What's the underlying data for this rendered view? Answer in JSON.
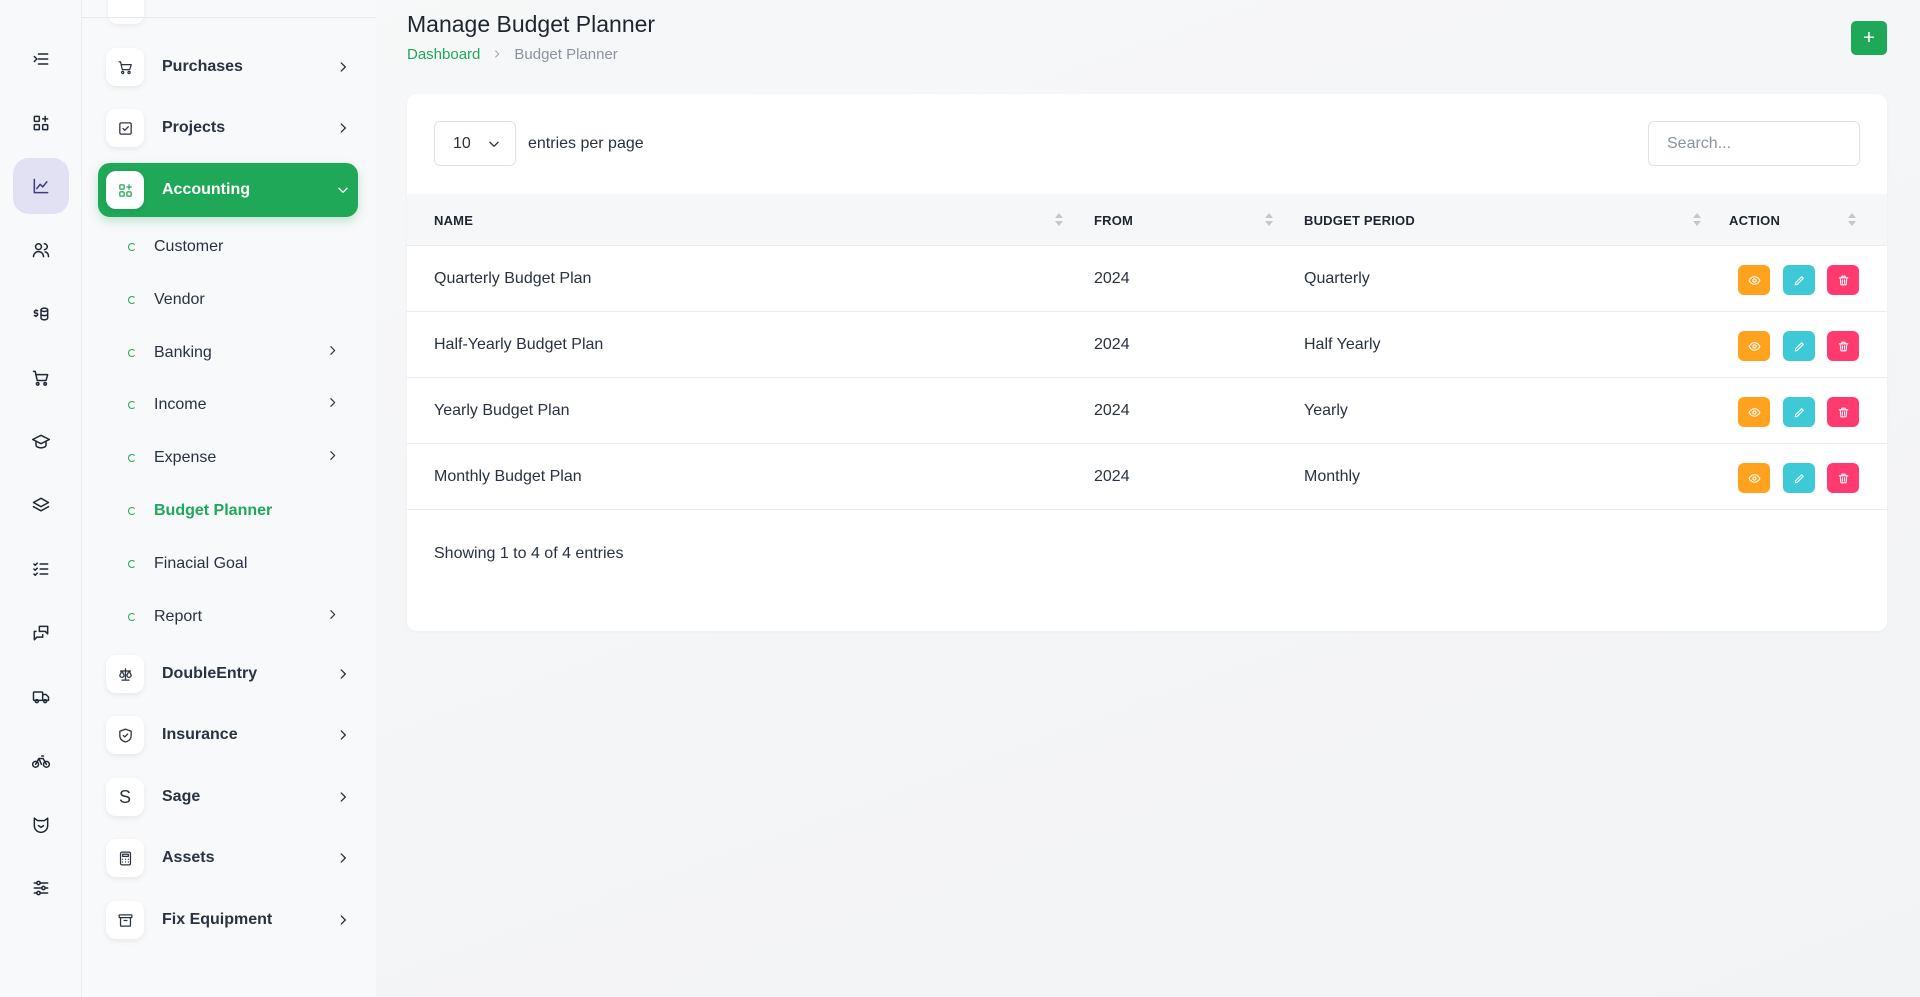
{
  "sidebar": {
    "items_top": [
      {
        "label": "Purchases"
      },
      {
        "label": "Projects"
      },
      {
        "label": "Accounting"
      }
    ],
    "accounting_sub": [
      {
        "label": "Customer"
      },
      {
        "label": "Vendor"
      },
      {
        "label": "Banking"
      },
      {
        "label": "Income"
      },
      {
        "label": "Expense"
      },
      {
        "label": "Budget Planner"
      },
      {
        "label": "Finacial Goal"
      },
      {
        "label": "Report"
      }
    ],
    "items_bottom": [
      {
        "label": "DoubleEntry"
      },
      {
        "label": "Insurance"
      },
      {
        "label": "Sage",
        "icon_letter": "S"
      },
      {
        "label": "Assets"
      },
      {
        "label": "Fix Equipment"
      }
    ]
  },
  "page": {
    "title": "Manage Budget Planner",
    "breadcrumb_home": "Dashboard",
    "breadcrumb_current": "Budget Planner",
    "add_label": "+"
  },
  "table_controls": {
    "entries_value": "10",
    "entries_label": "entries per page",
    "search_placeholder": "Search..."
  },
  "table": {
    "columns": [
      "NAME",
      "FROM",
      "BUDGET PERIOD",
      "ACTION"
    ],
    "rows": [
      {
        "name": "Quarterly Budget Plan",
        "from": "2024",
        "period": "Quarterly"
      },
      {
        "name": "Half-Yearly Budget Plan",
        "from": "2024",
        "period": "Half Yearly"
      },
      {
        "name": "Yearly Budget Plan",
        "from": "2024",
        "period": "Yearly"
      },
      {
        "name": "Monthly Budget Plan",
        "from": "2024",
        "period": "Monthly"
      }
    ],
    "footer": "Showing 1 to 4 of 4 entries"
  },
  "colors": {
    "accent": "#1fa858",
    "view": "#ffa21d",
    "edit": "#3ec9d6",
    "delete": "#ff3a6e"
  }
}
